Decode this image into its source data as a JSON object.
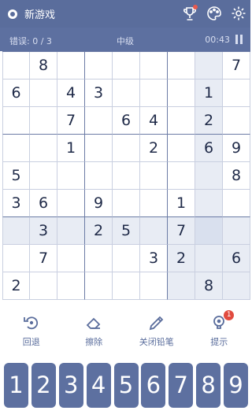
{
  "top_bar": {
    "new_game_label": "新游戏",
    "icons": [
      "trophy-icon",
      "palette-icon",
      "gear-icon"
    ]
  },
  "status": {
    "mistakes": "错误: 0 / 3",
    "level": "中级",
    "timer": "00:43"
  },
  "board": {
    "rows": [
      [
        "",
        "8",
        "",
        "",
        "",
        "",
        "",
        "",
        "7"
      ],
      [
        "6",
        "",
        "4",
        "3",
        "",
        "",
        "",
        "1",
        ""
      ],
      [
        "",
        "",
        "7",
        "",
        "6",
        "4",
        "",
        "2",
        ""
      ],
      [
        "",
        "",
        "1",
        "",
        "",
        "2",
        "",
        "6",
        "9"
      ],
      [
        "5",
        "",
        "",
        "",
        "",
        "",
        "",
        "",
        "8"
      ],
      [
        "3",
        "6",
        "",
        "9",
        "",
        "",
        "1",
        "",
        ""
      ],
      [
        "",
        "3",
        "",
        "2",
        "5",
        "",
        "7",
        "",
        ""
      ],
      [
        "",
        "7",
        "",
        "",
        "",
        "3",
        "2",
        "",
        "6"
      ],
      [
        "2",
        "",
        "",
        "",
        "",
        "",
        "",
        "8",
        ""
      ]
    ],
    "selected_cell": {
      "row": 6,
      "col": 7
    }
  },
  "tools": [
    {
      "label": "回退",
      "icon": "undo-icon"
    },
    {
      "label": "擦除",
      "icon": "eraser-icon"
    },
    {
      "label": "关闭铅笔",
      "icon": "pencil-icon"
    },
    {
      "label": "提示",
      "icon": "bulb-icon",
      "badge": "1"
    }
  ],
  "numpad": [
    "1",
    "2",
    "3",
    "4",
    "5",
    "6",
    "7",
    "8",
    "9"
  ]
}
